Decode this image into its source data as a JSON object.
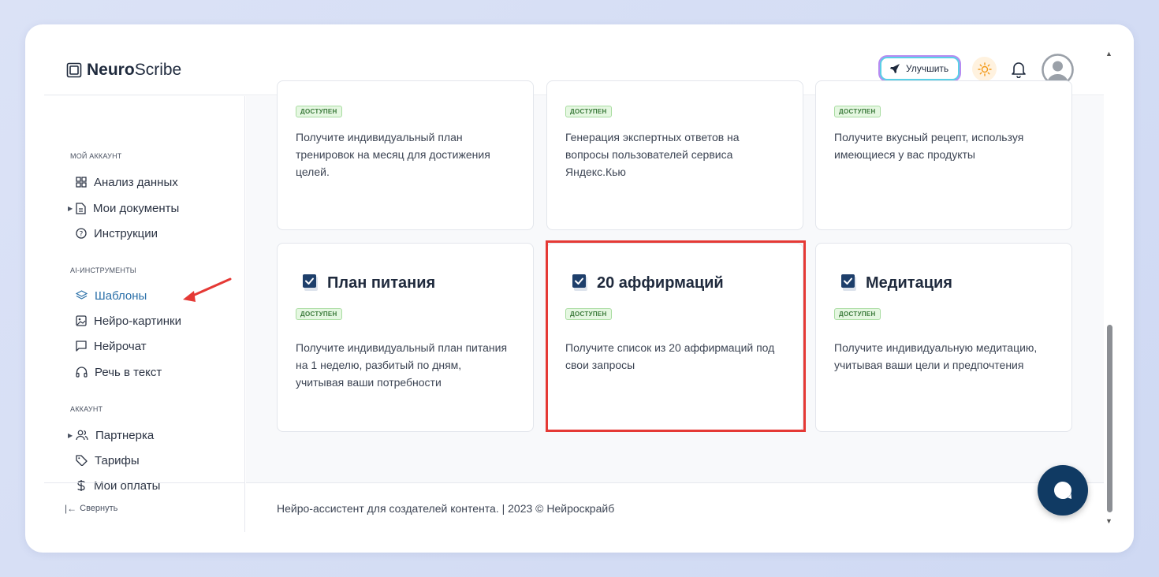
{
  "brand": {
    "bold": "Neuro",
    "regular": "Scribe"
  },
  "header": {
    "upgrade_label": "Улучшить"
  },
  "sidebar": {
    "sections": [
      {
        "title": "МОЙ АККАУНТ"
      },
      {
        "title": "AI-ИНСТРУМЕНТЫ"
      },
      {
        "title": "АККАУНТ"
      }
    ],
    "items": [
      {
        "label": "Анализ данных"
      },
      {
        "label": "Мои документы"
      },
      {
        "label": "Инструкции"
      },
      {
        "label": "Шаблоны"
      },
      {
        "label": "Нейро-картинки"
      },
      {
        "label": "Нейрочат"
      },
      {
        "label": "Речь в текст"
      },
      {
        "label": "Партнерка"
      },
      {
        "label": "Тарифы"
      },
      {
        "label": "Мои оплаты"
      }
    ],
    "collapse_label": "Свернуть"
  },
  "cards_top": [
    {
      "badge": "ДОСТУПЕН",
      "desc": "Получите индивидуальный план тренировок на месяц для достижения целей."
    },
    {
      "badge": "ДОСТУПЕН",
      "desc": "Генерация экспертных ответов на вопросы пользователей сервиса Яндекс.Кью"
    },
    {
      "badge": "ДОСТУПЕН",
      "desc": "Получите вкусный рецепт, используя имеющиеся у вас продукты"
    }
  ],
  "cards_bottom": [
    {
      "title": "План питания",
      "badge": "ДОСТУПЕН",
      "desc": "Получите индивидуальный план питания на 1 неделю, разбитый по дням, учитывая ваши потребности"
    },
    {
      "title": "20 аффирмаций",
      "badge": "ДОСТУПЕН",
      "desc": "Получите список из 20 аффирмаций под свои запросы"
    },
    {
      "title": "Медитация",
      "badge": "ДОСТУПЕН",
      "desc": "Получите индивидуальную медитацию, учитывая ваши цели и предпочтения"
    }
  ],
  "footer": {
    "text": "Нейро-ассистент для создателей контента.  | 2023 © Нейроскрайб"
  },
  "colors": {
    "accent": "#2a6fa8",
    "highlight": "#e53935",
    "chat": "#103a63",
    "badge_bg": "#e5f7e1"
  }
}
